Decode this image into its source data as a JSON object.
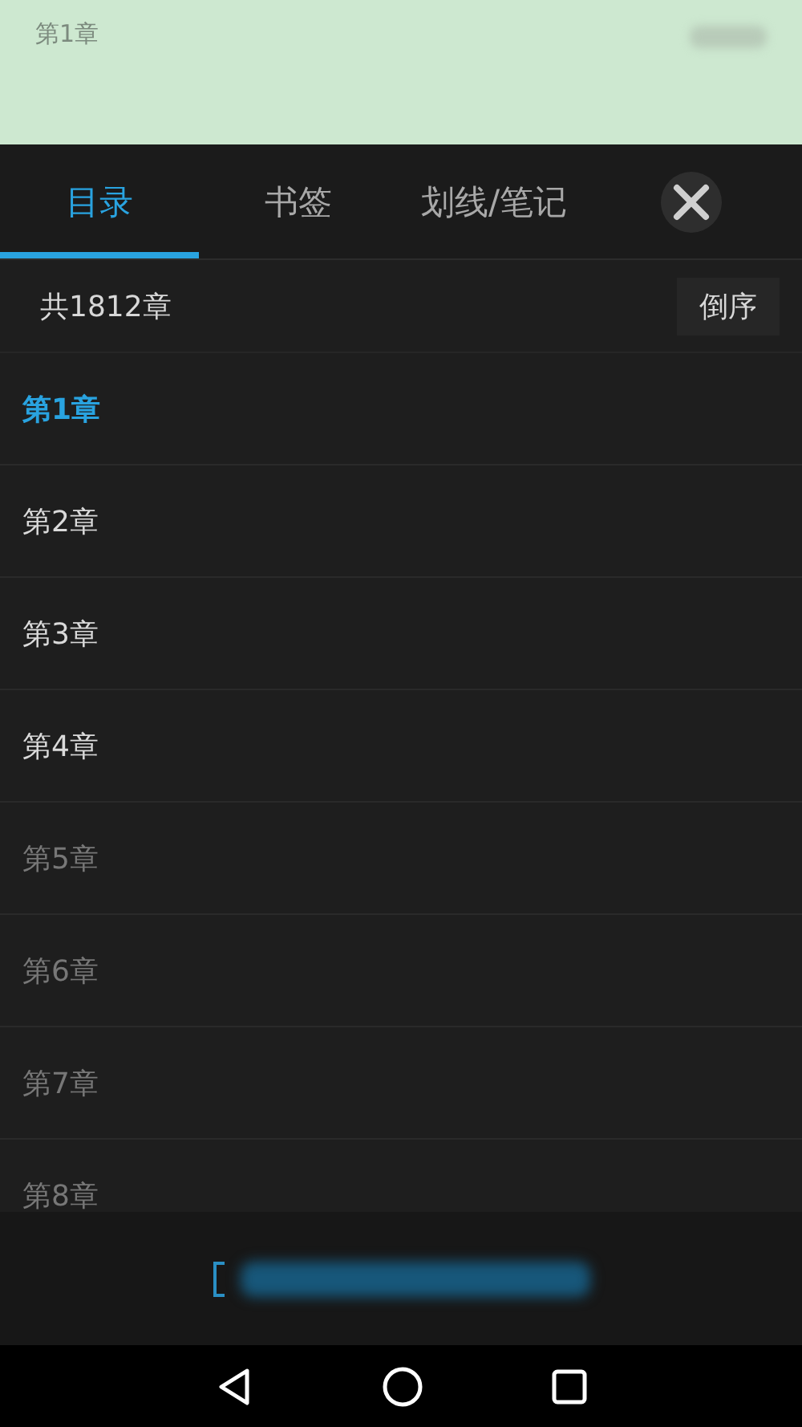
{
  "reader": {
    "chapter_title": "第1章"
  },
  "tabs": [
    {
      "label": "目录",
      "selected": true
    },
    {
      "label": "书签",
      "selected": false
    },
    {
      "label": "划线/笔记",
      "selected": false
    }
  ],
  "toc": {
    "count": "共1812章",
    "sort_button": "倒序"
  },
  "chapters": [
    {
      "title": "第1章",
      "selected": true,
      "downloaded": true
    },
    {
      "title": "第2章",
      "selected": false,
      "downloaded": true
    },
    {
      "title": "第3章",
      "selected": false,
      "downloaded": true
    },
    {
      "title": "第4章",
      "selected": false,
      "downloaded": true
    },
    {
      "title": "第5章",
      "selected": false,
      "downloaded": false
    },
    {
      "title": "第6章",
      "selected": false,
      "downloaded": false
    },
    {
      "title": "第7章",
      "selected": false,
      "downloaded": false
    },
    {
      "title": "第8章",
      "selected": false,
      "downloaded": false
    }
  ]
}
